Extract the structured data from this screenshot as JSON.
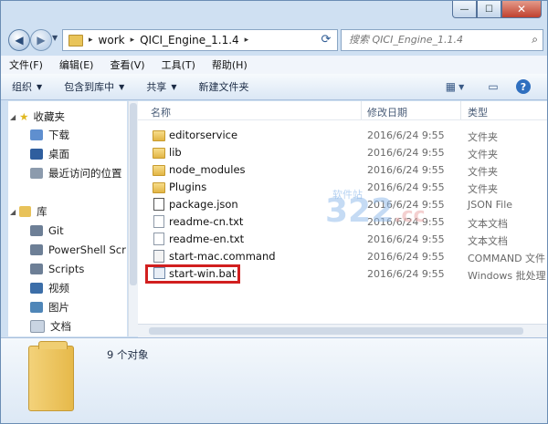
{
  "window": {
    "caption_min": "—",
    "caption_max": "☐",
    "caption_close": "✕"
  },
  "address": {
    "segments": [
      "work",
      "QICI_Engine_1.1.4"
    ],
    "separator": "▸",
    "search_placeholder": "搜索 QICI_Engine_1.1.4"
  },
  "menu": [
    "文件(F)",
    "编辑(E)",
    "查看(V)",
    "工具(T)",
    "帮助(H)"
  ],
  "toolbar": {
    "organize": "组织",
    "include_in_library": "包含到库中",
    "share": "共享",
    "new_folder": "新建文件夹"
  },
  "nav": {
    "favorites_header": "收藏夹",
    "favorites": [
      "下载",
      "桌面",
      "最近访问的位置"
    ],
    "libraries_header": "库",
    "libraries": [
      "Git",
      "PowerShell Scr",
      "Scripts",
      "视频",
      "图片",
      "文档"
    ]
  },
  "columns": {
    "name": "名称",
    "date": "修改日期",
    "type": "类型"
  },
  "files": [
    {
      "name": "editorservice",
      "date": "2016/6/24 9:55",
      "type": "文件夹",
      "icon": "folder-icon"
    },
    {
      "name": "lib",
      "date": "2016/6/24 9:55",
      "type": "文件夹",
      "icon": "folder-icon"
    },
    {
      "name": "node_modules",
      "date": "2016/6/24 9:55",
      "type": "文件夹",
      "icon": "folder-icon"
    },
    {
      "name": "Plugins",
      "date": "2016/6/24 9:55",
      "type": "文件夹",
      "icon": "folder-icon"
    },
    {
      "name": "package.json",
      "date": "2016/6/24 9:55",
      "type": "JSON File",
      "icon": "json-file-icon"
    },
    {
      "name": "readme-cn.txt",
      "date": "2016/6/24 9:55",
      "type": "文本文档",
      "icon": "text-file-icon"
    },
    {
      "name": "readme-en.txt",
      "date": "2016/6/24 9:55",
      "type": "文本文档",
      "icon": "text-file-icon"
    },
    {
      "name": "start-mac.command",
      "date": "2016/6/24 9:55",
      "type": "COMMAND 文件",
      "icon": "command-file-icon"
    },
    {
      "name": "start-win.bat",
      "date": "2016/6/24 9:55",
      "type": "Windows 批处理",
      "icon": "batch-file-icon"
    }
  ],
  "watermark": {
    "number": "322",
    "site": "软件站",
    "suffix": ".cc"
  },
  "status": {
    "count": "9 个对象"
  },
  "colors": {
    "highlight": "#d11f1f",
    "folder": "#e6b94a"
  }
}
